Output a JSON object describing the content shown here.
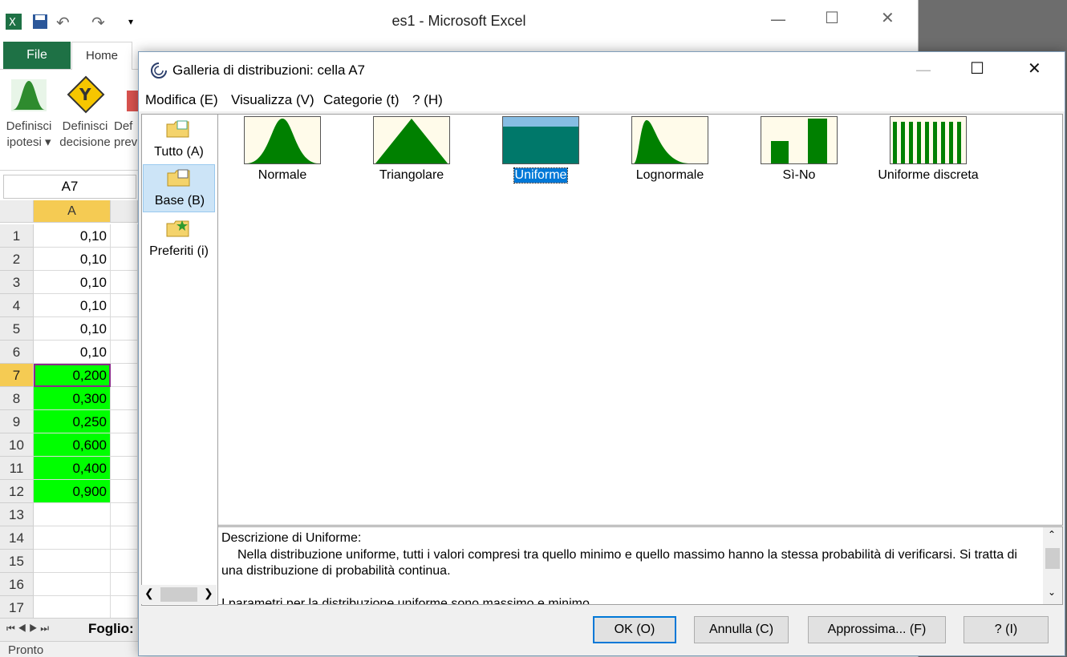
{
  "excel": {
    "title": "es1  -  Microsoft Excel",
    "tabs": {
      "file": "File",
      "home": "Home"
    },
    "ribbon": {
      "define_assumption": [
        "Definisci",
        "ipotesi"
      ],
      "define_decision": [
        "Definisci",
        "decisione"
      ],
      "define_forecast": [
        "Def",
        "prev"
      ]
    },
    "namebox": "A7",
    "column_header": "A",
    "rows": [
      {
        "n": "1",
        "v": "0,10",
        "green": false
      },
      {
        "n": "2",
        "v": "0,10",
        "green": false
      },
      {
        "n": "3",
        "v": "0,10",
        "green": false
      },
      {
        "n": "4",
        "v": "0,10",
        "green": false
      },
      {
        "n": "5",
        "v": "0,10",
        "green": false
      },
      {
        "n": "6",
        "v": "0,10",
        "green": false
      },
      {
        "n": "7",
        "v": "0,200",
        "green": true
      },
      {
        "n": "8",
        "v": "0,300",
        "green": true
      },
      {
        "n": "9",
        "v": "0,250",
        "green": true
      },
      {
        "n": "10",
        "v": "0,600",
        "green": true
      },
      {
        "n": "11",
        "v": "0,400",
        "green": true
      },
      {
        "n": "12",
        "v": "0,900",
        "green": true
      },
      {
        "n": "13",
        "v": "",
        "green": false
      },
      {
        "n": "14",
        "v": "",
        "green": false
      },
      {
        "n": "15",
        "v": "",
        "green": false
      },
      {
        "n": "16",
        "v": "",
        "green": false
      },
      {
        "n": "17",
        "v": "",
        "green": false
      }
    ],
    "sheet_tab": "Foglio:",
    "status": "Pronto"
  },
  "dialog": {
    "title": "Galleria di distribuzioni: cella A7",
    "menu": [
      "Modifica (E)",
      "Visualizza (V)",
      "Categorie (t)",
      "? (H)"
    ],
    "categories": [
      "Tutto (A)",
      "Base (B)",
      "Preferiti (i)"
    ],
    "distributions": [
      "Normale",
      "Triangolare",
      "Uniforme",
      "Lognormale",
      "Sì-No",
      "Uniforme discreta"
    ],
    "selected_distribution": "Uniforme",
    "description": {
      "heading": "Descrizione di Uniforme:",
      "body": "Nella distribuzione uniforme, tutti i valori compresi tra quello minimo e quello massimo hanno la stessa probabilità di verificarsi. Si tratta di una distribuzione di probabilità continua.",
      "params": "I parametri per la distribuzione uniforme sono massimo e minimo."
    },
    "buttons": {
      "ok": "OK (O)",
      "cancel": "Annulla (C)",
      "fit": "Approssima... (F)",
      "help": "? (I)"
    }
  },
  "colors": {
    "green_fill": "#00ff00",
    "dist_green": "#008000",
    "excel_green": "#1e7145",
    "selection_blue": "#0078d7"
  }
}
